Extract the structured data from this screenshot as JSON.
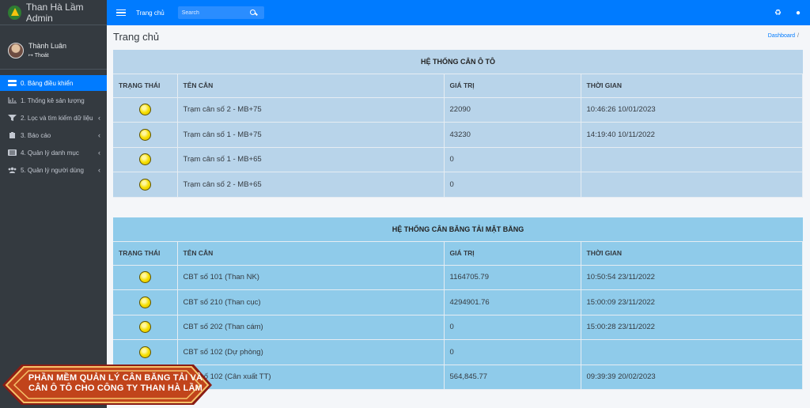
{
  "app": {
    "title": "Than Hà Lầm Admin"
  },
  "user": {
    "name": "Thành Luân",
    "logout_label": "Thoát"
  },
  "menu": [
    {
      "label": "0. Bảng điều khiển",
      "icon": "dashboard-icon",
      "active": true
    },
    {
      "label": "1. Thống kê sản lượng",
      "icon": "chart-icon"
    },
    {
      "label": "2. Lọc và tìm kiếm dữ liệu",
      "icon": "filter-icon"
    },
    {
      "label": "3. Báo cáo",
      "icon": "clipboard-icon"
    },
    {
      "label": "4. Quản lý danh mục",
      "icon": "list-icon"
    },
    {
      "label": "5. Quản lý người dùng",
      "icon": "users-icon"
    }
  ],
  "topbar": {
    "home_label": "Trang chủ",
    "search_placeholder": "Search"
  },
  "page": {
    "title": "Trang chủ",
    "breadcrumb": "Dashboard",
    "breadcrumb_separator": "/"
  },
  "panels": [
    {
      "title": "HỆ THỐNG CÂN Ô TÔ",
      "headers": [
        "TRẠNG THÁI",
        "TÊN CÂN",
        "GIÁ TRỊ",
        "THỜI GIAN"
      ],
      "rows": [
        {
          "name": "Trạm cân số 2 - MB+75",
          "value": "22090",
          "time": "10:46:26 10/01/2023"
        },
        {
          "name": "Trạm cân số 1 - MB+75",
          "value": "43230",
          "time": "14:19:40 10/11/2022"
        },
        {
          "name": "Trạm cân số 1 - MB+65",
          "value": "0",
          "time": ""
        },
        {
          "name": "Trạm cân số 2 - MB+65",
          "value": "0",
          "time": ""
        }
      ]
    },
    {
      "title": "HỆ THỐNG CÂN BĂNG TẢI MẶT BẰNG",
      "headers": [
        "TRẠNG THÁI",
        "TÊN CÂN",
        "GIÁ TRỊ",
        "THỜI GIAN"
      ],
      "rows": [
        {
          "name": "CBT số 101 (Than NK)",
          "value": "1164705.79",
          "time": "10:50:54 23/11/2022"
        },
        {
          "name": "CBT số 210 (Than cục)",
          "value": "4294901.76",
          "time": "15:00:09 23/11/2022"
        },
        {
          "name": "CBT số 202 (Than cám)",
          "value": "0",
          "time": "15:00:28 23/11/2022"
        },
        {
          "name": "CBT số 102 (Dự phòng)",
          "value": "0",
          "time": ""
        },
        {
          "name": "CBT số 102 (Cân xuất TT)",
          "value": "564,845.77",
          "time": "09:39:39 20/02/2023"
        }
      ]
    }
  ],
  "banner": {
    "text": "PHẦN MỀM QUẢN LÝ CÂN BĂNG TẢI VÀ CÂN Ô TÔ CHO CÔNG TY THAN HÀ LẦM",
    "color": "#c1441b"
  },
  "colors": {
    "primary": "#007bff",
    "sidebar": "#343a40",
    "panel_auto": "#b8d4ea",
    "panel_belt": "#8fcbea",
    "status_light": "#f7df00"
  }
}
